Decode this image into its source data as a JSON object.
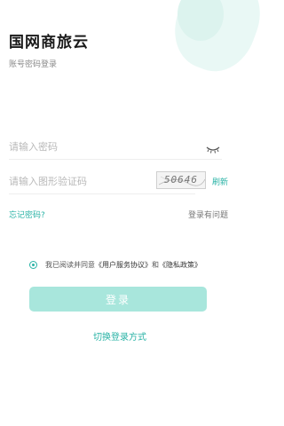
{
  "header": {
    "title": "国网商旅云",
    "subtitle": "账号密码登录"
  },
  "form": {
    "password_placeholder": "请输入密码",
    "captcha_placeholder": "请输入图形验证码",
    "captcha_code": "50646",
    "refresh_label": "刷新"
  },
  "links": {
    "forgot_password": "忘记密码?",
    "login_problem": "登录有问题"
  },
  "agreement": {
    "prefix": "我已阅读并同意",
    "user_agreement": "《用户服务协议》",
    "and": "和",
    "privacy_policy": "《隐私政策》"
  },
  "actions": {
    "login_label": "登录",
    "switch_method": "切换登录方式"
  },
  "colors": {
    "accent": "#2ab3a6",
    "button_disabled": "#a8e6dc"
  }
}
